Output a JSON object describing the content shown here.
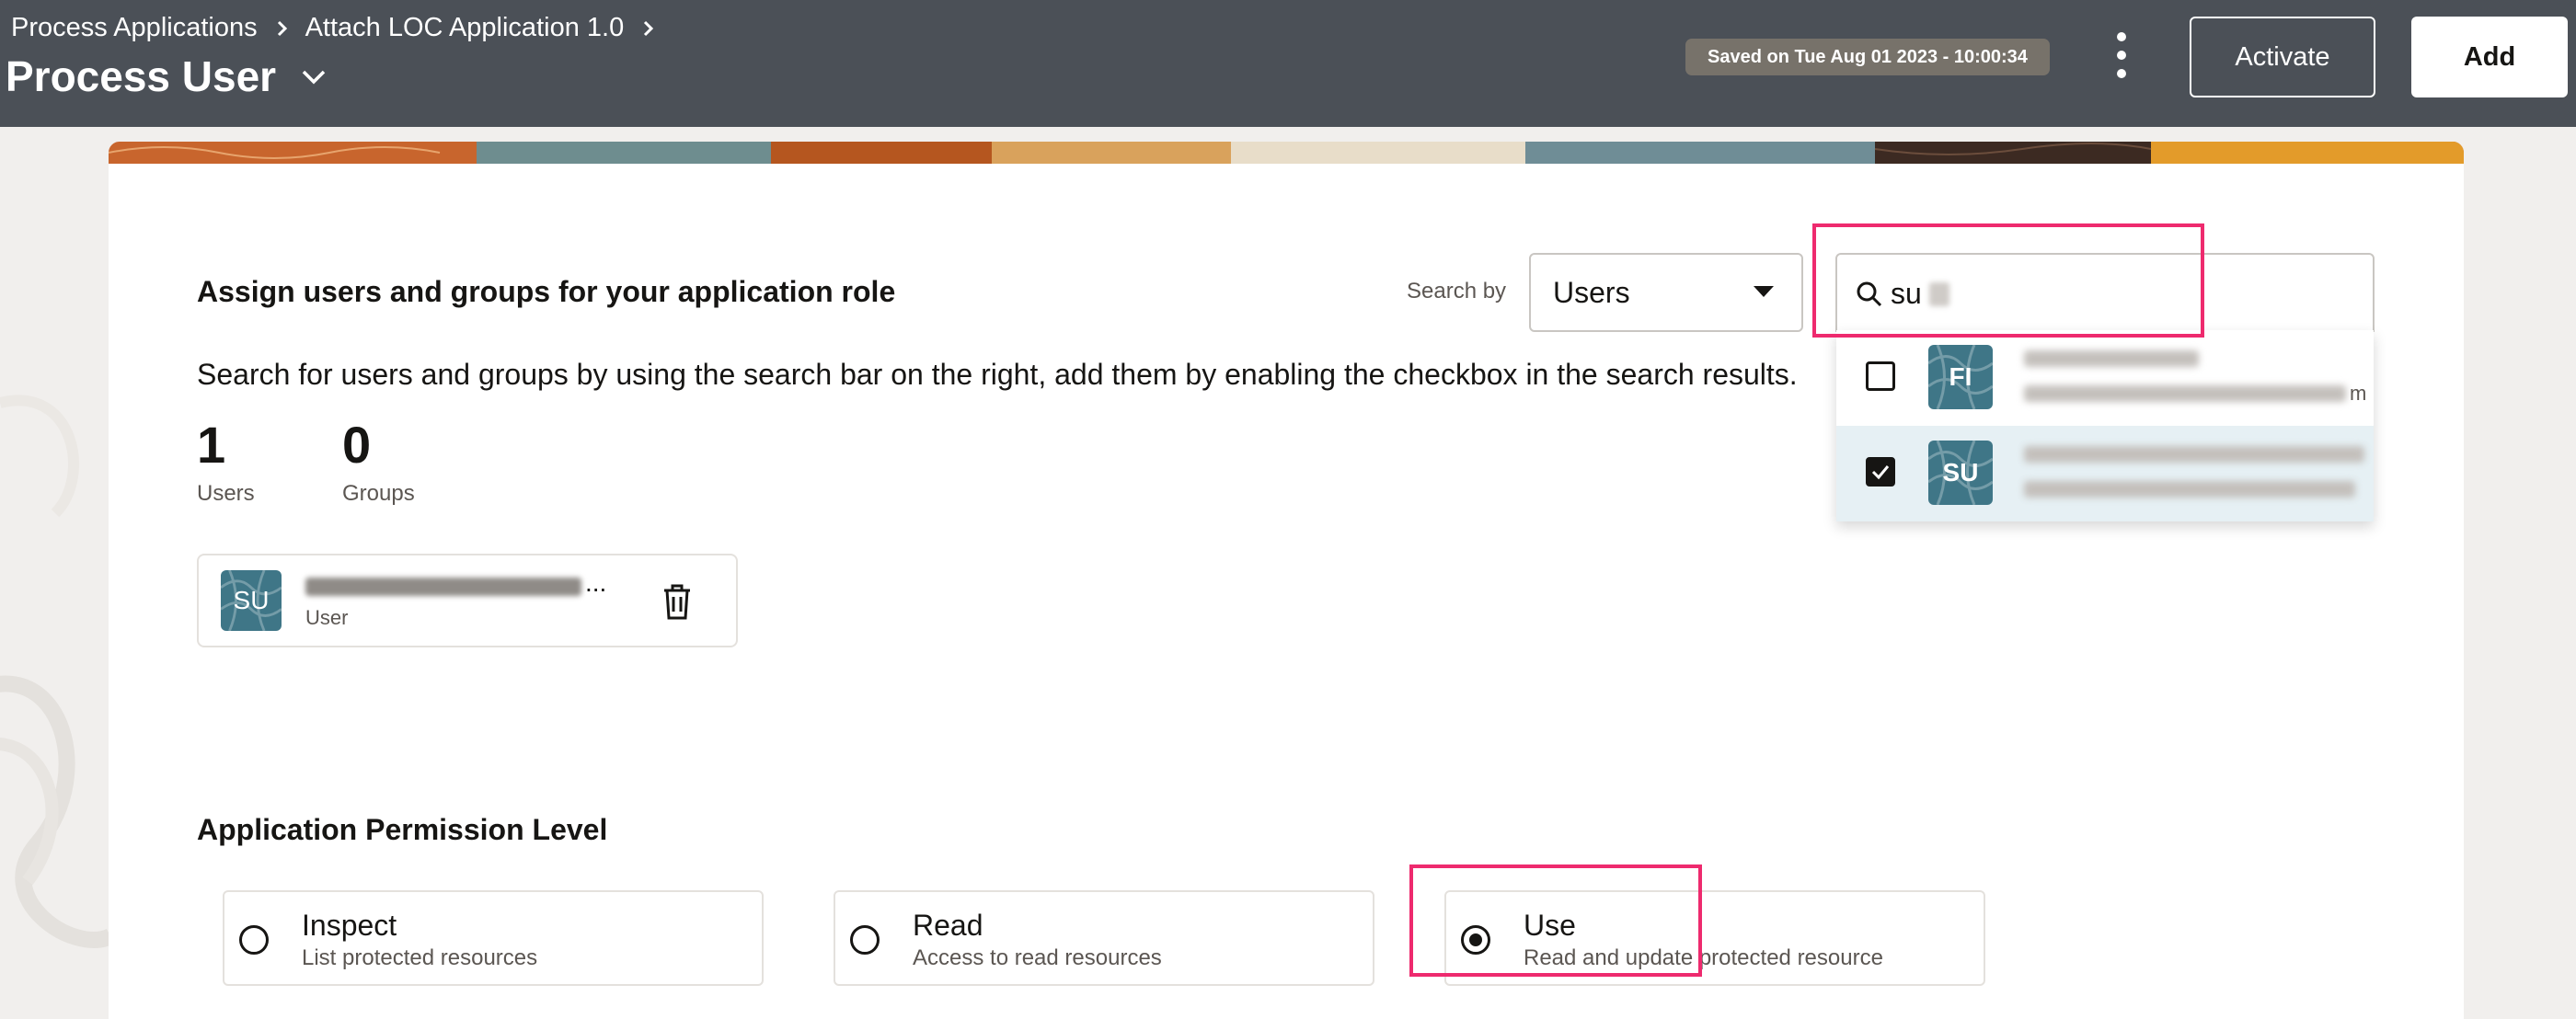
{
  "header": {
    "breadcrumbs": [
      "Process Applications",
      "Attach LOC Application 1.0"
    ],
    "title": "Process User",
    "saved_status": "Saved on Tue Aug 01 2023 - 10:00:34",
    "activate_label": "Activate",
    "add_label": "Add"
  },
  "assign": {
    "title": "Assign users and groups for your application role",
    "search_by_label": "Search by",
    "search_by_value": "Users",
    "search_value": "su",
    "description": "Search for users and groups by using the search bar on the right, add them by enabling the checkbox in the search results."
  },
  "results": [
    {
      "initials": "FI",
      "checked": false,
      "tail": "m"
    },
    {
      "initials": "SU",
      "checked": true,
      "tail": ""
    }
  ],
  "stats": {
    "users_count": "1",
    "users_label": "Users",
    "groups_count": "0",
    "groups_label": "Groups"
  },
  "assigned_user": {
    "initials": "SU",
    "ellipsis": "...",
    "type": "User"
  },
  "permissions": {
    "title": "Application Permission Level",
    "options": [
      {
        "name": "Inspect",
        "description": "List protected resources",
        "selected": false
      },
      {
        "name": "Read",
        "description": "Access to read resources",
        "selected": false
      },
      {
        "name": "Use",
        "description": "Read and update protected resource",
        "selected": true
      }
    ]
  },
  "colors": {
    "header_bg": "#4b5057",
    "avatar_bg": "#3f7687",
    "highlight": "#ee2a6e",
    "selected_row_bg": "#e6f0f4"
  }
}
